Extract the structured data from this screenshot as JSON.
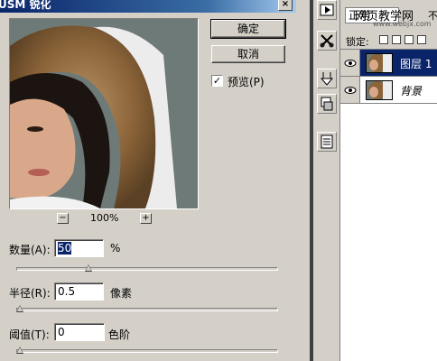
{
  "dialog": {
    "title": "USM 锐化",
    "close_glyph": "×",
    "ok_label": "确定",
    "cancel_label": "取消",
    "preview_checkbox": {
      "label": "预览(P)",
      "checked": true,
      "glyph": "✓"
    },
    "zoom": {
      "minus": "−",
      "value": "100%",
      "plus": "+"
    },
    "amount": {
      "label": "数量(A):",
      "value": "50",
      "unit": "%",
      "slider_fraction": 0.27
    },
    "radius": {
      "label": "半径(R):",
      "value": "0.5",
      "unit": "像素",
      "slider_fraction": 0.0
    },
    "threshold": {
      "label": "阈值(T):",
      "value": "0",
      "unit": "色阶",
      "slider_fraction": 0.0
    }
  },
  "tools": [
    {
      "icon": "play-icon",
      "glyph": "▶"
    },
    {
      "icon": "scissors-icon",
      "glyph": "✂"
    },
    {
      "icon": "wand-icon",
      "glyph": "⚚"
    },
    {
      "icon": "brush-preset-icon",
      "glyph": "▤"
    },
    {
      "icon": "document-icon",
      "glyph": "▦"
    }
  ],
  "layers": {
    "blend_mode": "正常",
    "opacity_label": "不",
    "watermark_text": "网页教学网",
    "watermark_url": "www.webjx.com",
    "lock_label": "锁定:",
    "lock_icons": [
      "□",
      "✎",
      "✛",
      "🔒"
    ],
    "items": [
      {
        "name": "图层 1",
        "visible": true,
        "selected": true
      },
      {
        "name": "背景",
        "visible": true,
        "selected": false
      }
    ]
  },
  "colors": {
    "accent": "#0a246a",
    "titlebar_end": "#a6caf0",
    "panel": "#d4d0c8"
  }
}
